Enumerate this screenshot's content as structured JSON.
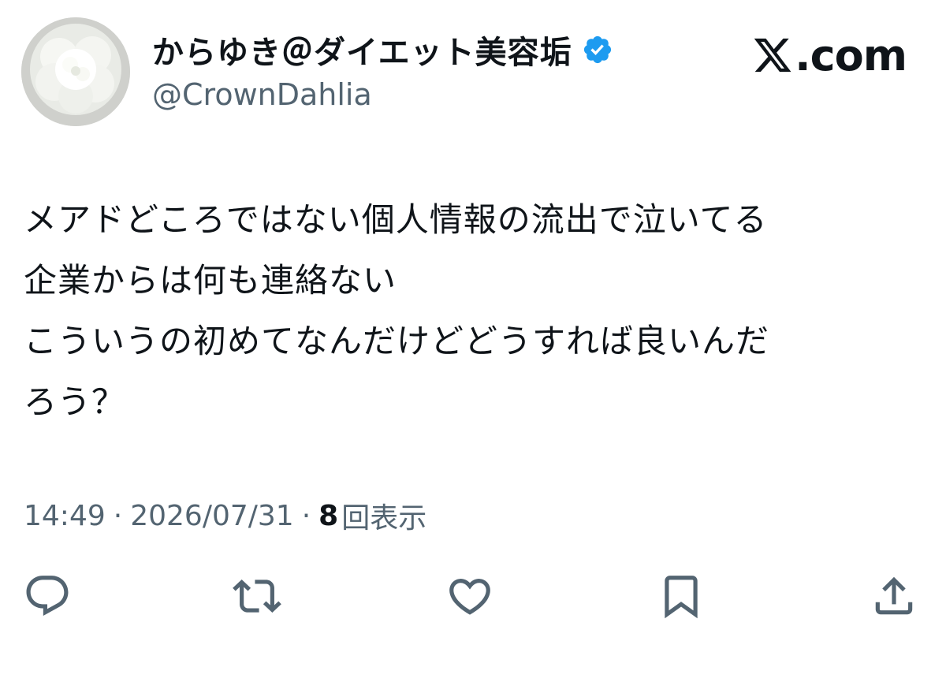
{
  "header": {
    "display_name": "からゆき＠ダイエット美容垢",
    "handle": "@CrownDahlia",
    "brand_label": ".com",
    "verified_color": "#1d9bf0"
  },
  "tweet": {
    "lines": [
      "メアドどころではない個人情報の流出で泣いてる",
      "企業からは何も連絡ない",
      "こういうの初めてなんだけどどうすれば良いんだ",
      "ろう？"
    ]
  },
  "meta": {
    "time": "14:49",
    "date": "2026/07/31",
    "separator": "·",
    "views_count": "8",
    "views_label": "回表示"
  },
  "actions": {
    "icons": [
      "reply-icon",
      "retweet-icon",
      "like-icon",
      "bookmark-icon",
      "share-icon"
    ],
    "icon_color": "#536471"
  }
}
